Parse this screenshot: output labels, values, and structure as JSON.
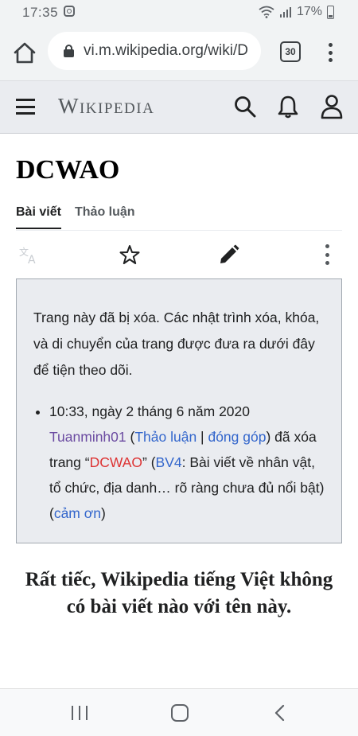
{
  "status_bar": {
    "time": "17:35",
    "battery": "17%"
  },
  "browser": {
    "url": "vi.m.wikipedia.org/wiki/D",
    "tab_count": "30"
  },
  "header": {
    "logo": "Wikipedia"
  },
  "page": {
    "title": "DCWAO",
    "tabs": [
      {
        "label": "Bài viết",
        "active": true
      },
      {
        "label": "Thảo luận",
        "active": false
      }
    ]
  },
  "notice": {
    "text": "Trang này đã bị xóa. Các nhật trình xóa, khóa, và di chuyển của trang được đưa ra dưới đây để tiện theo dõi.",
    "log": {
      "datetime": "10:33, ngày 2 tháng 6 năm 2020",
      "user": "Tuanminh01",
      "open_paren": " (",
      "talk": "Thảo luận",
      "separator": " | ",
      "contribs": "đóng góp",
      "deleted_text": ") đã xóa trang “",
      "page": "DCWAO",
      "reason_open": "” (",
      "reason_code": "BV4",
      "reason_text": ": Bài viết về nhân vật, tổ chức, địa danh… rõ ràng chưa đủ nổi bật) (",
      "thanks": "cảm ơn",
      "close": ")"
    }
  },
  "missing_message": "Rất tiếc, Wikipedia tiếng Việt không có bài viết nào với tên này.",
  "colors": {
    "link": "#3366cc",
    "redlink": "#dd3333",
    "visited": "#6b4ba1",
    "notice_bg": "#eaecf0"
  }
}
